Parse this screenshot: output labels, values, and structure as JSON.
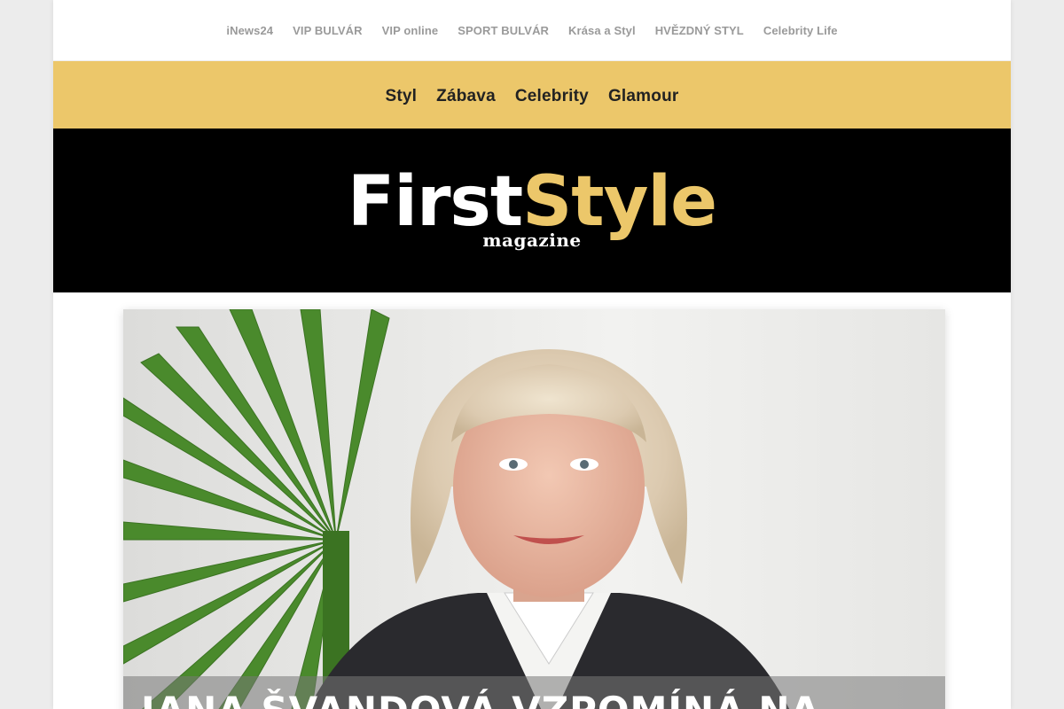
{
  "network_links": [
    "iNews24",
    "VIP BULVÁR",
    "VIP online",
    "SPORT BULVÁR",
    "Krása a Styl",
    "HVĚZDNÝ STYL",
    "Celebrity Life"
  ],
  "categories": [
    "Styl",
    "Zábava",
    "Celebrity",
    "Glamour"
  ],
  "logo": {
    "word1": "First",
    "word2": "Style",
    "subtitle": "magazine"
  },
  "hero": {
    "headline": "JANA ŠVANDOVÁ VZPOMÍNÁ NA",
    "image_description_icon": "portrait-photo"
  },
  "colors": {
    "accent_gold": "#ecc76a",
    "logo_band": "#000000",
    "link_gray": "#9a9a9a"
  }
}
